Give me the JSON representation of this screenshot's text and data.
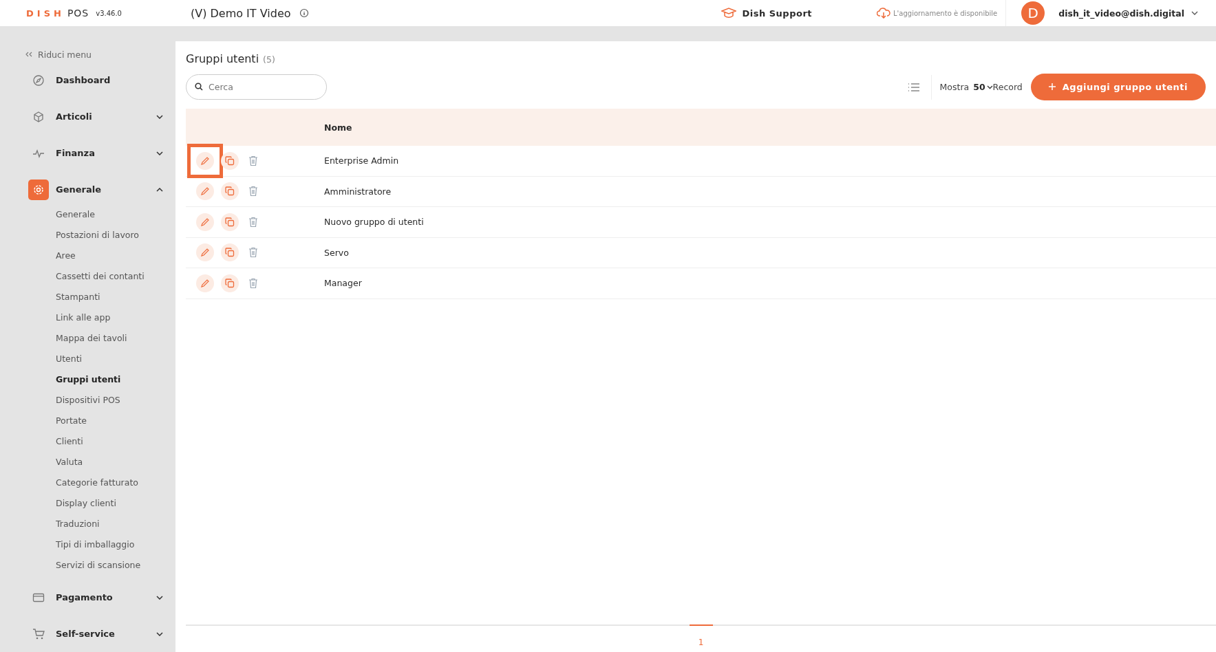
{
  "header": {
    "brand": "DISH",
    "product": "POS",
    "version": "v3.46.0",
    "venue": "(V) Demo IT Video",
    "support": "Dish Support",
    "update_notice": "L'aggiornamento è disponibile",
    "avatar_letter": "D",
    "account": "dish_it_video@dish.digital"
  },
  "sidebar": {
    "collapse": "Riduci menu",
    "items": [
      {
        "label": "Dashboard",
        "active": false
      },
      {
        "label": "Articoli",
        "active": false,
        "expanded": false
      },
      {
        "label": "Finanza",
        "active": false,
        "expanded": false
      },
      {
        "label": "Generale",
        "active": true,
        "expanded": true,
        "children": [
          {
            "label": "Generale",
            "selected": false
          },
          {
            "label": "Postazioni di lavoro",
            "selected": false
          },
          {
            "label": "Aree",
            "selected": false
          },
          {
            "label": "Cassetti dei contanti",
            "selected": false
          },
          {
            "label": "Stampanti",
            "selected": false
          },
          {
            "label": "Link alle app",
            "selected": false
          },
          {
            "label": "Mappa dei tavoli",
            "selected": false
          },
          {
            "label": "Utenti",
            "selected": false
          },
          {
            "label": "Gruppi utenti",
            "selected": true
          },
          {
            "label": "Dispositivi POS",
            "selected": false
          },
          {
            "label": "Portate",
            "selected": false
          },
          {
            "label": "Clienti",
            "selected": false
          },
          {
            "label": "Valuta",
            "selected": false
          },
          {
            "label": "Categorie fatturato",
            "selected": false
          },
          {
            "label": "Display clienti",
            "selected": false
          },
          {
            "label": "Traduzioni",
            "selected": false
          },
          {
            "label": "Tipi di imballaggio",
            "selected": false
          },
          {
            "label": "Servizi di scansione",
            "selected": false
          }
        ]
      },
      {
        "label": "Pagamento",
        "active": false,
        "expanded": false
      },
      {
        "label": "Self-service",
        "active": false,
        "expanded": false
      }
    ]
  },
  "page": {
    "title": "Gruppi utenti",
    "count": "(5)",
    "search": {
      "placeholder": "Cerca"
    },
    "show_label": "Mostra",
    "page_size": "50",
    "records_label": "Record",
    "add_button": "Aggiungi gruppo utenti"
  },
  "table": {
    "columns": [
      "Nome"
    ],
    "rows": [
      {
        "name": "Enterprise Admin",
        "highlighted": true
      },
      {
        "name": "Amministratore",
        "highlighted": false
      },
      {
        "name": "Nuovo gruppo di utenti",
        "highlighted": false
      },
      {
        "name": "Servo",
        "highlighted": false
      },
      {
        "name": "Manager",
        "highlighted": false
      }
    ]
  },
  "pagination": {
    "pages": [
      {
        "label": "1",
        "selected": true
      }
    ]
  }
}
